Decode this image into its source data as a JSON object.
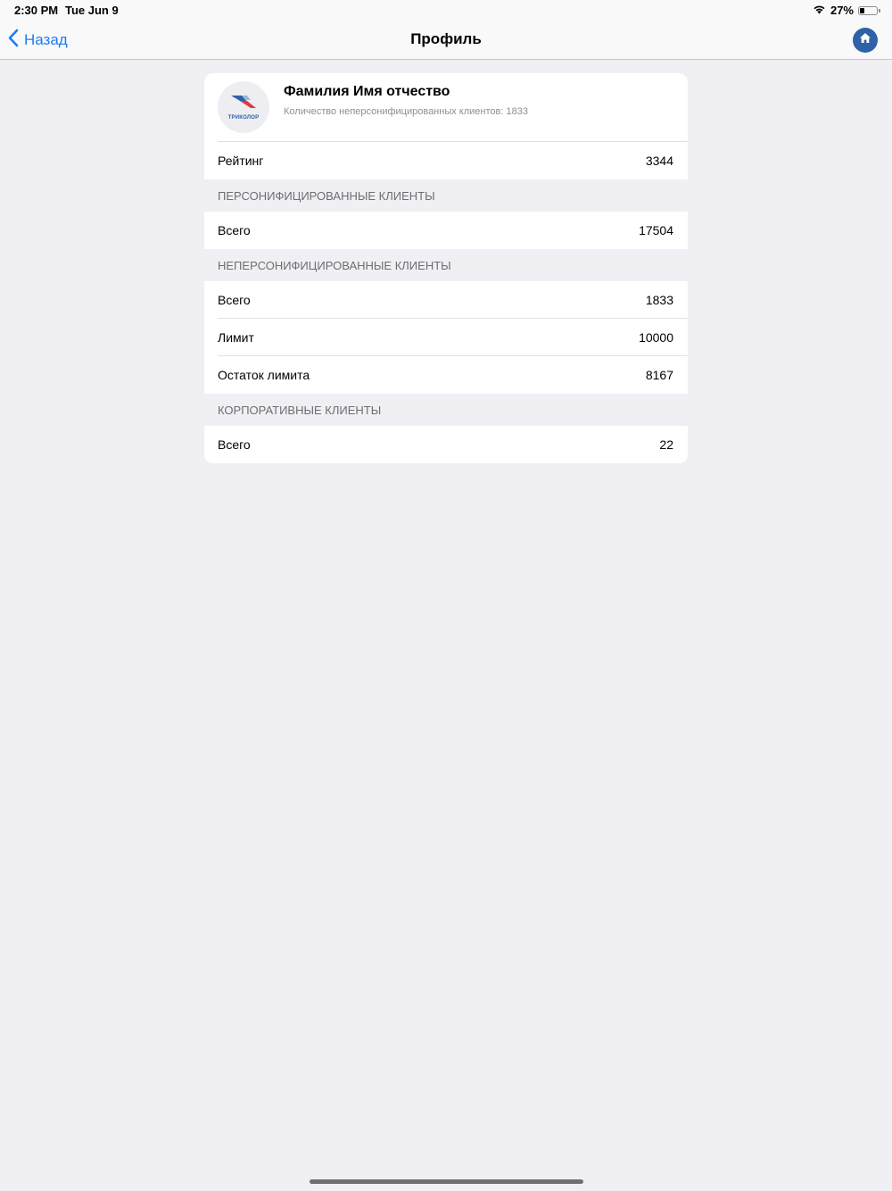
{
  "status_bar": {
    "time": "2:30 PM",
    "date": "Tue Jun 9",
    "battery": "27%",
    "battery_level": 0.27
  },
  "nav": {
    "back_label": "Назад",
    "title": "Профиль"
  },
  "profile": {
    "name": "Фамилия Имя отчество",
    "subtitle": "Количество неперсонифицированных клиентов: 1833",
    "logo_text": "ТРИКОЛОР",
    "rating_label": "Рейтинг",
    "rating_value": "3344"
  },
  "sections": {
    "personalized": {
      "header": "ПЕРСОНИФИЦИРОВАННЫЕ КЛИЕНТЫ",
      "total_label": "Всего",
      "total_value": "17504"
    },
    "non_personalized": {
      "header": "НЕПЕРСОНИФИЦИРОВАННЫЕ КЛИЕНТЫ",
      "total_label": "Всего",
      "total_value": "1833",
      "limit_label": "Лимит",
      "limit_value": "10000",
      "remaining_label": "Остаток лимита",
      "remaining_value": "8167"
    },
    "corporate": {
      "header": "КОРПОРАТИВНЫЕ КЛИЕНТЫ",
      "total_label": "Всего",
      "total_value": "22"
    }
  },
  "icons": {
    "back": "chevron-left-icon",
    "home": "home-icon",
    "wifi": "wifi-icon",
    "battery": "battery-icon"
  },
  "colors": {
    "accent": "#1f7bf2",
    "home_button": "#2e62a6",
    "background": "#efeff4"
  }
}
